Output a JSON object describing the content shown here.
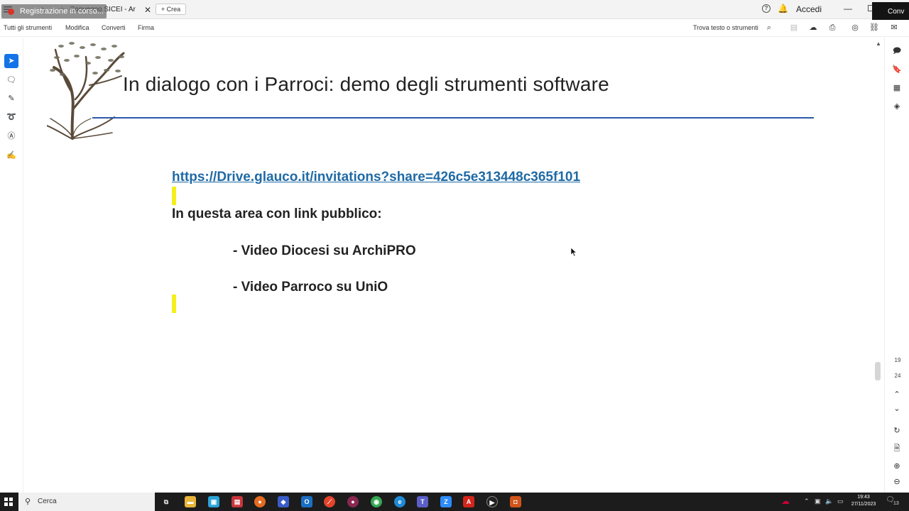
{
  "titlebar": {
    "recording_label": "Registrazione in corso...",
    "tab_title": "Convegno SICEI - Ar",
    "new_tab_label": "Crea",
    "signin_label": "Accedi",
    "convert_label": "Conv"
  },
  "menubar": {
    "items": [
      "Tutti gli strumenti",
      "Modifica",
      "Converti",
      "Firma"
    ],
    "find_label": "Trova testo o strumenti"
  },
  "document": {
    "title": "In dialogo con i Parroci: demo degli strumenti software",
    "link": "https://Drive.glauco.it/invitations?share=426c5e313448c365f101",
    "intro": "In questa area con link pubblico:",
    "bullets": [
      "- Video Diocesi su ArchiPRO",
      "- Video Parroco su UniO"
    ]
  },
  "pagination": {
    "current_page": "19",
    "total_pages": "24"
  },
  "taskbar": {
    "search_placeholder": "Cerca",
    "time": "19:43",
    "date": "27/11/2023",
    "notification_count": "13"
  },
  "colors": {
    "accent": "#1473e6",
    "title_rule": "#2b5aa8",
    "link": "#1f6aa5",
    "highlight": "#f5ee1a"
  }
}
